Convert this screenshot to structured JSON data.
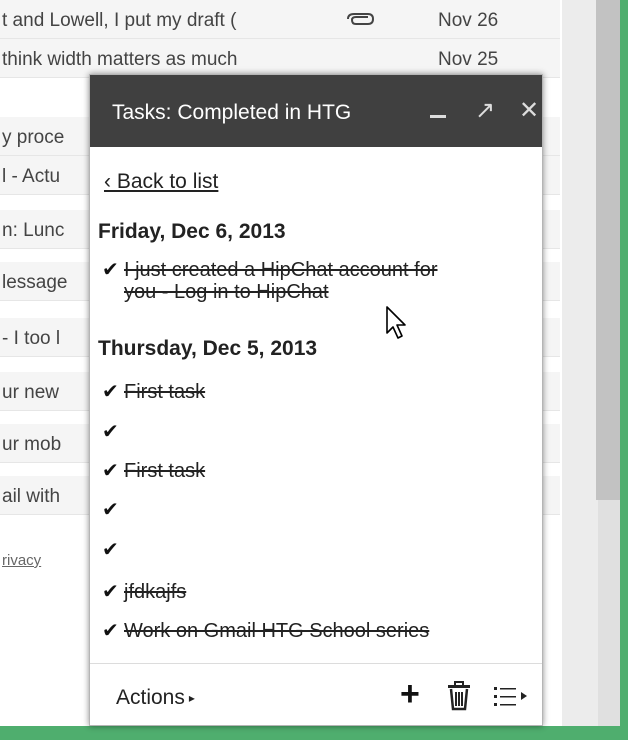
{
  "inbox": {
    "rows": [
      {
        "snippet": "t and Lowell, I put my draft (",
        "date": "Nov 26",
        "attachment": true
      },
      {
        "snippet": "think width matters as much",
        "date": "Nov 25",
        "attachment": false
      },
      {
        "snippet": "y proce",
        "date": "",
        "attachment": false
      },
      {
        "snippet": "l - Actu",
        "date": "",
        "attachment": false
      },
      {
        "snippet": "n: Lunc",
        "date": "",
        "attachment": false
      },
      {
        "snippet": "lessage",
        "date": "",
        "attachment": false
      },
      {
        "snippet": "- I too l",
        "date": "",
        "attachment": false
      },
      {
        "snippet": "ur new",
        "date": "",
        "attachment": false
      },
      {
        "snippet": "ur mob",
        "date": "",
        "attachment": false
      },
      {
        "snippet": "ail with",
        "date": "",
        "attachment": false
      }
    ],
    "privacy_link": "rivacy"
  },
  "tasks_panel": {
    "title": "Tasks: Completed in HTG",
    "minimize_icon": "minimize-icon",
    "popout_glyph": "↗",
    "close_glyph": "✕",
    "back_link": "‹ Back to list",
    "groups": [
      {
        "date": "Friday, Dec 6, 2013",
        "tasks": [
          {
            "line1": "I just created a HipChat account for",
            "line2": "you - Log in to HipChat"
          }
        ]
      },
      {
        "date": "Thursday, Dec 5, 2013",
        "tasks": [
          {
            "text": "First task"
          },
          {
            "text": ""
          },
          {
            "text": "First task"
          },
          {
            "text": ""
          },
          {
            "text": ""
          },
          {
            "text": "jfdkajfs"
          },
          {
            "text": "Work on Gmail HTG School series"
          }
        ]
      }
    ],
    "check_glyph": "✔",
    "footer": {
      "actions_label": "Actions",
      "actions_arrow": "▸",
      "add_glyph": "+"
    }
  },
  "colors": {
    "header_bg": "#404040",
    "window_frame": "#4fae6e"
  }
}
